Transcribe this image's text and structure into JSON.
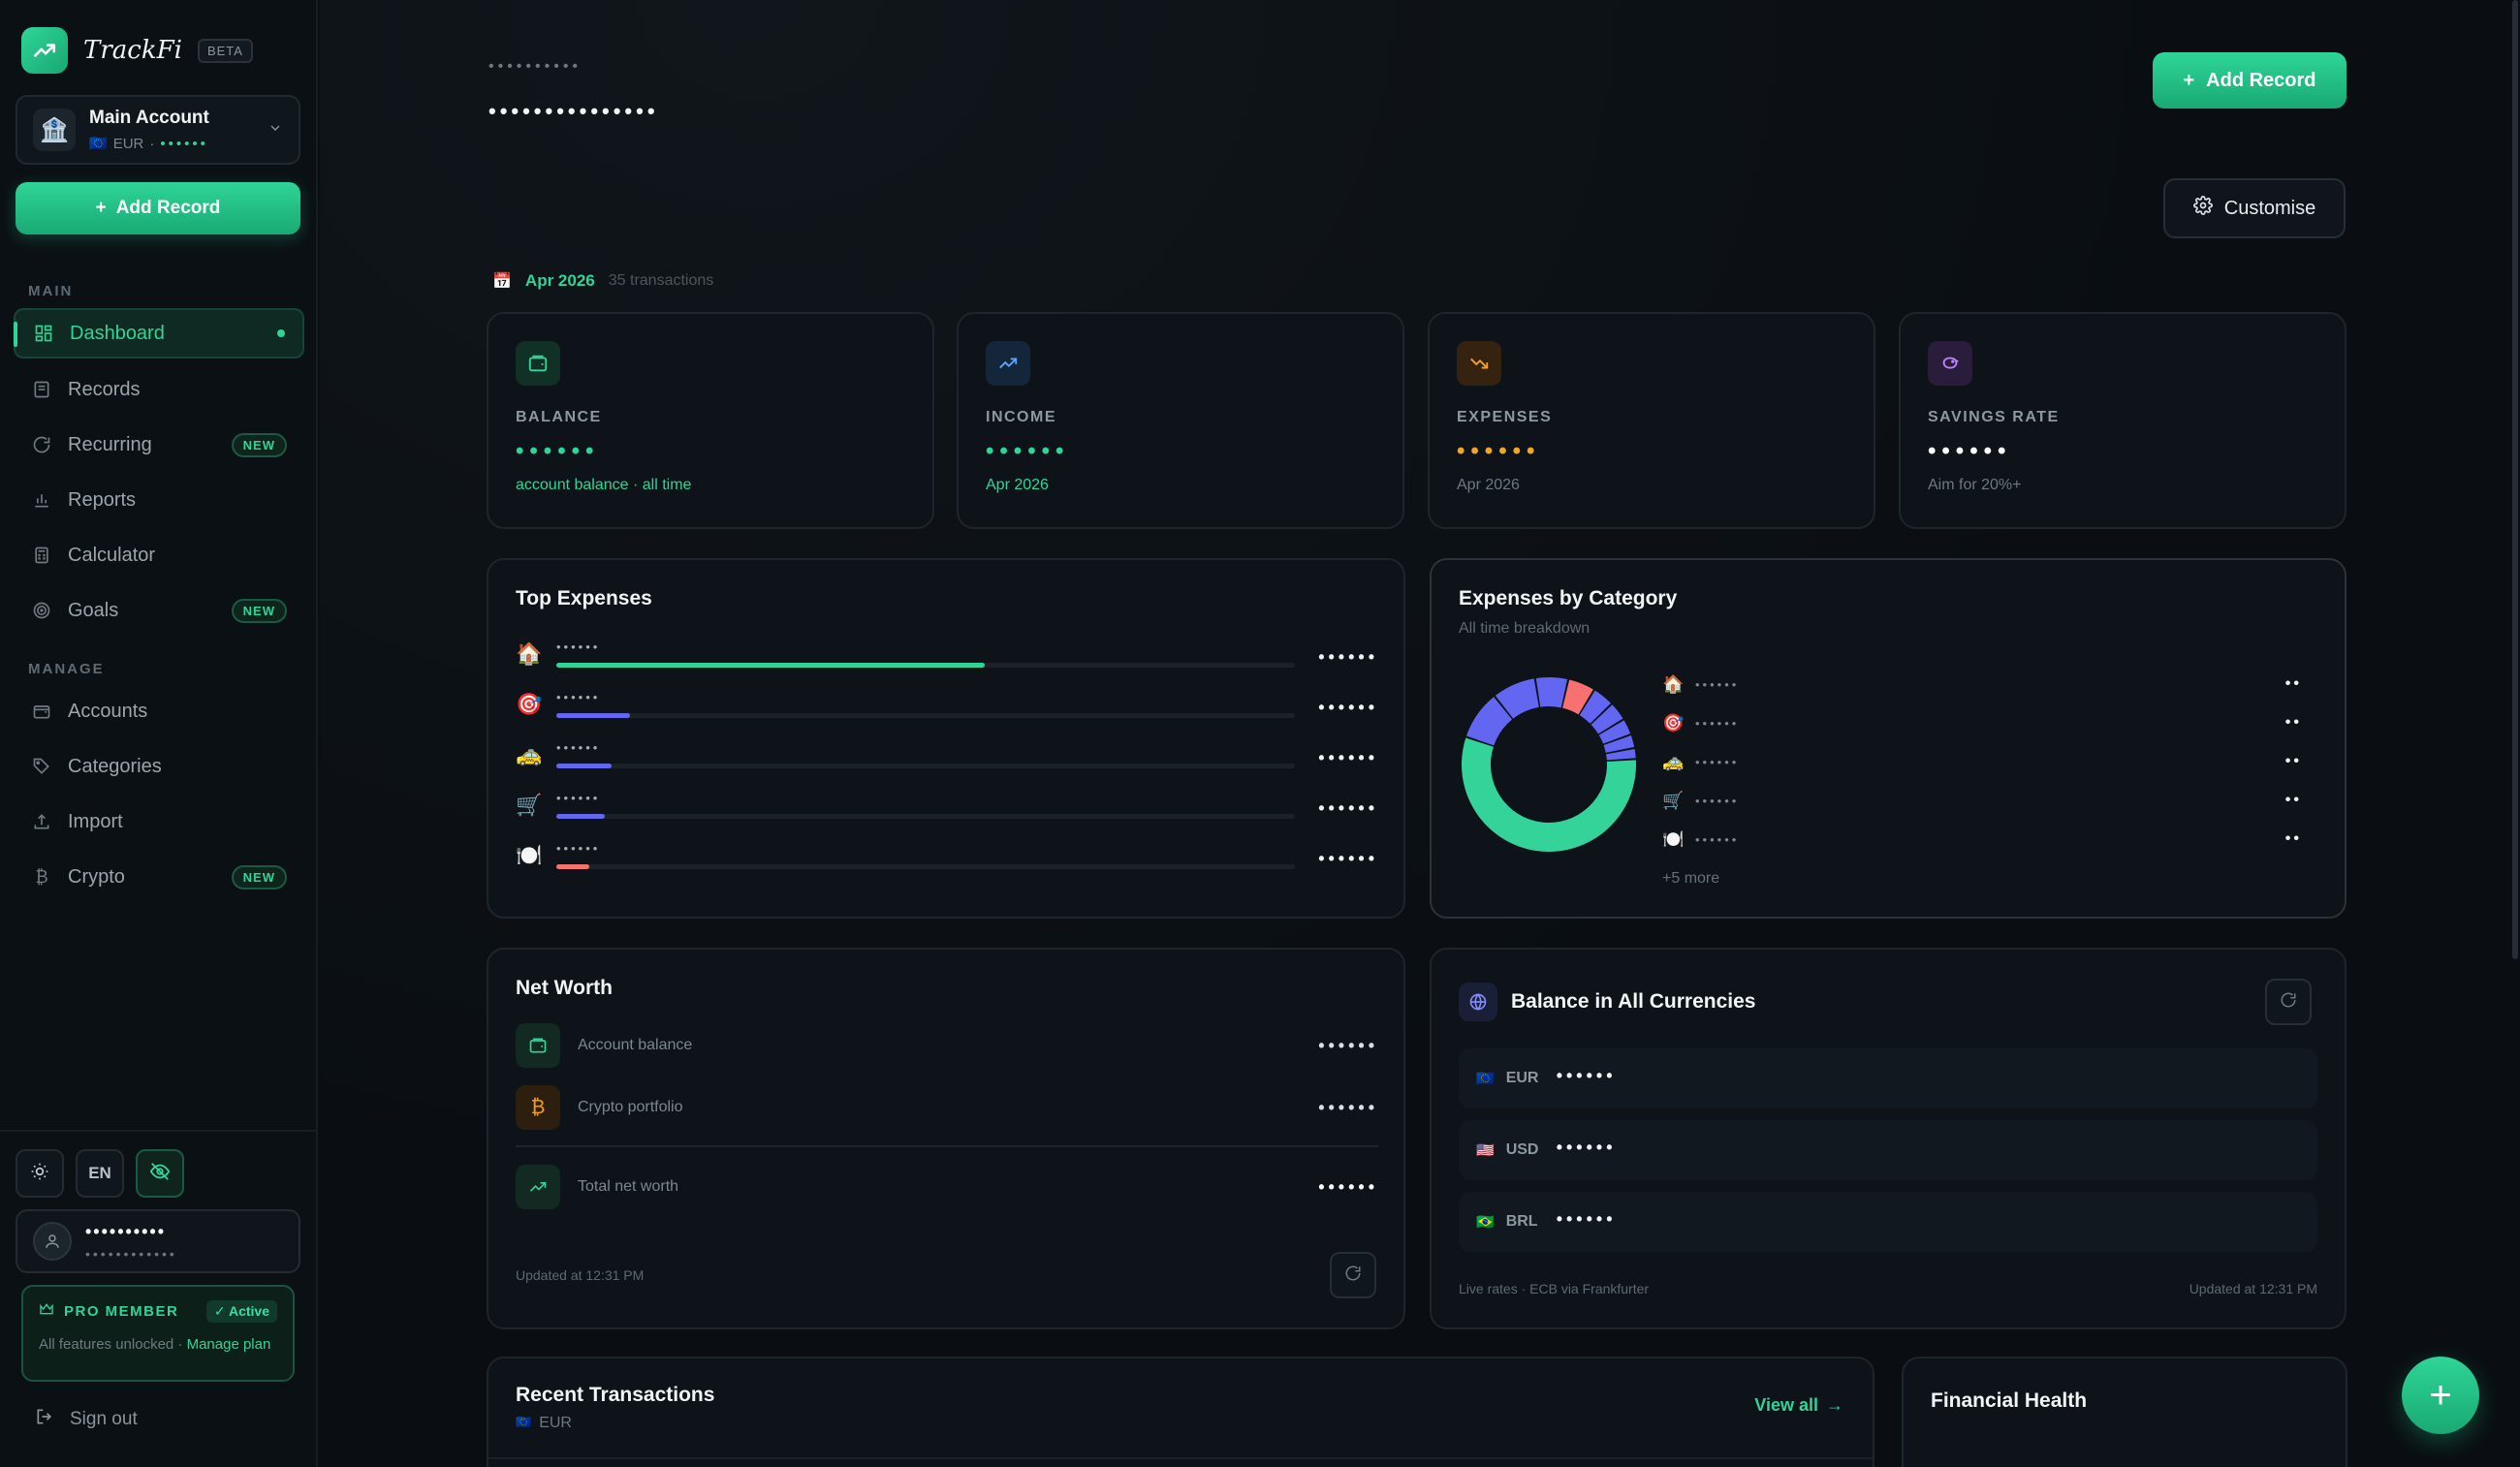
{
  "brand": {
    "name": "TrackFi",
    "badge": "BETA"
  },
  "account": {
    "name": "Main Account",
    "flag": "🇪🇺",
    "currency": "EUR",
    "separator": "·",
    "masked_balance": "••••••"
  },
  "sidebar": {
    "add_record": "Add Record",
    "section_main": "MAIN",
    "section_manage": "MANAGE",
    "items": [
      {
        "label": "Dashboard"
      },
      {
        "label": "Records"
      },
      {
        "label": "Recurring",
        "badge": "NEW"
      },
      {
        "label": "Reports"
      },
      {
        "label": "Calculator"
      },
      {
        "label": "Goals",
        "badge": "NEW"
      },
      {
        "label": "Accounts"
      },
      {
        "label": "Categories"
      },
      {
        "label": "Import"
      },
      {
        "label": "Crypto",
        "badge": "NEW"
      }
    ],
    "language": "EN",
    "user": {
      "name": "••••••••••",
      "email": "••••••••••••"
    },
    "pro": {
      "title": "PRO MEMBER",
      "status": "✓ Active",
      "text": "All features unlocked · ",
      "link": "Manage plan"
    },
    "sign_out": "Sign out"
  },
  "header": {
    "greeting_masked": "••••••••••",
    "title_masked": "•••••••••••••••",
    "add_record": "Add Record",
    "customise": "Customise"
  },
  "period": {
    "icon": "📅",
    "month": "Apr 2026",
    "count": "35 transactions"
  },
  "stats": [
    {
      "label": "BALANCE",
      "value": "••••••",
      "sub": "account balance · all time",
      "color": "#2fd596"
    },
    {
      "label": "INCOME",
      "value": "••••••",
      "sub": "Apr 2026",
      "color": "#2fd596"
    },
    {
      "label": "EXPENSES",
      "value": "••••••",
      "sub": "Apr 2026",
      "color": "#f5a524"
    },
    {
      "label": "SAVINGS RATE",
      "value": "••••••",
      "sub": "Aim for 20%+",
      "color": "#ffffff"
    }
  ],
  "top_expenses": {
    "title": "Top Expenses",
    "items": [
      {
        "emoji": "🏠",
        "name": "••••••",
        "amount": "••••••",
        "fraction": 0.58,
        "color": "#2fd596"
      },
      {
        "emoji": "🎯",
        "name": "••••••",
        "amount": "••••••",
        "fraction": 0.1,
        "color": "#6366f1"
      },
      {
        "emoji": "🚕",
        "name": "••••••",
        "amount": "••••••",
        "fraction": 0.075,
        "color": "#6366f1"
      },
      {
        "emoji": "🛒",
        "name": "••••••",
        "amount": "••••••",
        "fraction": 0.065,
        "color": "#6366f1"
      },
      {
        "emoji": "🍽️",
        "name": "••••••",
        "amount": "••••••",
        "fraction": 0.045,
        "color": "#f87171"
      }
    ]
  },
  "expenses_by_category": {
    "title": "Expenses by Category",
    "subtitle": "All time breakdown",
    "items": [
      {
        "emoji": "🏠",
        "name": "••••••",
        "value": "••"
      },
      {
        "emoji": "🎯",
        "name": "••••••",
        "value": "••"
      },
      {
        "emoji": "🚕",
        "name": "••••••",
        "value": "••"
      },
      {
        "emoji": "🛒",
        "name": "••••••",
        "value": "••"
      },
      {
        "emoji": "🍽️",
        "name": "••••••",
        "value": "••"
      }
    ],
    "more": "+5 more",
    "slices": [
      {
        "value": 55,
        "color": "#34d399"
      },
      {
        "value": 9,
        "color": "#6366f1"
      },
      {
        "value": 8,
        "color": "#6366f1"
      },
      {
        "value": 6,
        "color": "#6366f1"
      },
      {
        "value": 5,
        "color": "#f87171"
      },
      {
        "value": 4,
        "color": "#6366f1"
      },
      {
        "value": 3.5,
        "color": "#6366f1"
      },
      {
        "value": 3,
        "color": "#6366f1"
      },
      {
        "value": 2.5,
        "color": "#6366f1"
      },
      {
        "value": 2,
        "color": "#6366f1"
      }
    ]
  },
  "net_worth": {
    "title": "Net Worth",
    "rows": [
      {
        "label": "Account balance",
        "value": "••••••"
      },
      {
        "label": "Crypto portfolio",
        "value": "••••••"
      },
      {
        "label": "Total net worth",
        "value": "••••••"
      }
    ],
    "updated": "Updated at 12:31 PM"
  },
  "currencies": {
    "title": "Balance in All Currencies",
    "rows": [
      {
        "flag": "🇪🇺",
        "code": "EUR",
        "value": "••••••"
      },
      {
        "flag": "🇺🇸",
        "code": "USD",
        "value": "••••••"
      },
      {
        "flag": "🇧🇷",
        "code": "BRL",
        "value": "••••••"
      }
    ],
    "footer_left": "Live rates · ECB via Frankfurter",
    "footer_right": "Updated at 12:31 PM"
  },
  "recent": {
    "title": "Recent Transactions",
    "flag": "🇪🇺",
    "currency": "EUR",
    "view_all": "View all"
  },
  "health": {
    "title": "Financial Health"
  }
}
